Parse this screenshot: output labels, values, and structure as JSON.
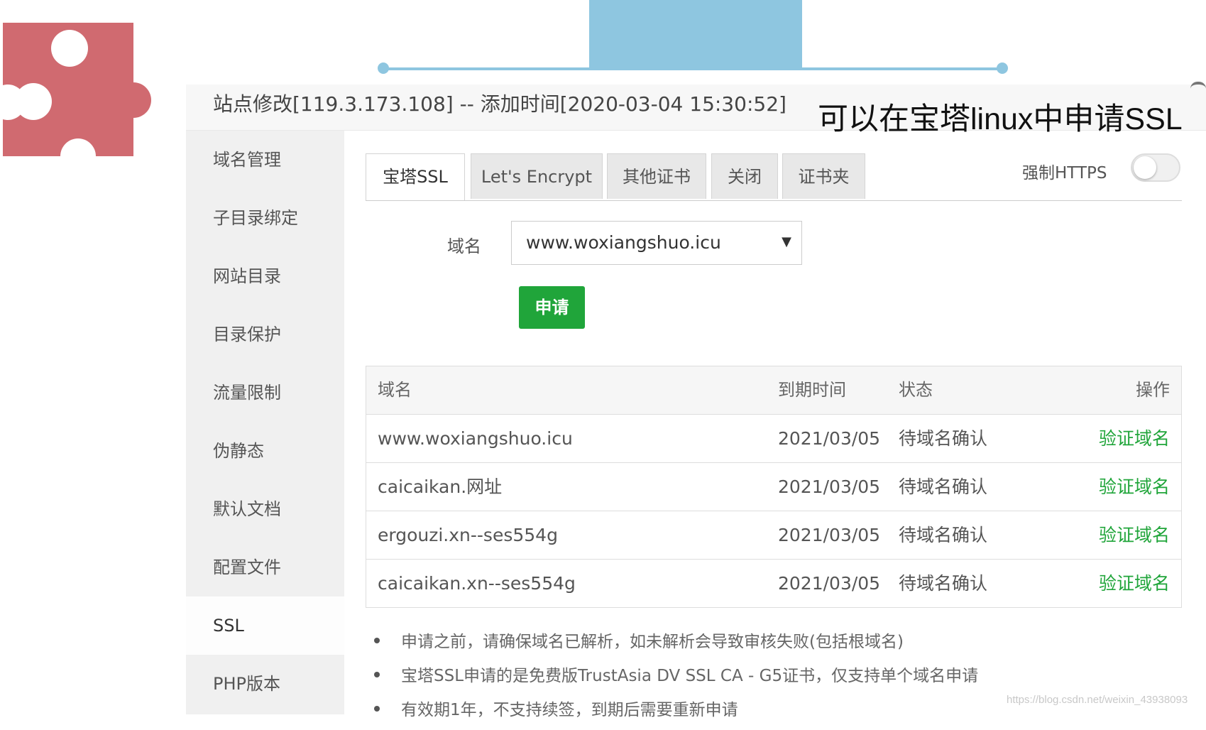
{
  "panel": {
    "title": "站点修改[119.3.173.108] -- 添加时间[2020-03-04 15:30:52]"
  },
  "callout": "可以在宝塔linux中申请SSL",
  "sidebar": {
    "items": [
      {
        "label": "域名管理"
      },
      {
        "label": "子目录绑定"
      },
      {
        "label": "网站目录"
      },
      {
        "label": "目录保护"
      },
      {
        "label": "流量限制"
      },
      {
        "label": "伪静态"
      },
      {
        "label": "默认文档"
      },
      {
        "label": "配置文件"
      },
      {
        "label": "SSL",
        "active": true
      },
      {
        "label": "PHP版本"
      }
    ]
  },
  "tabs": [
    {
      "label": "宝塔SSL",
      "active": true
    },
    {
      "label": "Let's Encrypt"
    },
    {
      "label": "其他证书"
    },
    {
      "label": "关闭"
    },
    {
      "label": "证书夹"
    }
  ],
  "force_https": {
    "label": "强制HTTPS",
    "enabled": false
  },
  "form": {
    "domain_label": "域名",
    "domain_value": "www.woxiangshuo.icu",
    "apply_label": "申请"
  },
  "table": {
    "headers": {
      "domain": "域名",
      "expire": "到期时间",
      "status": "状态",
      "action": "操作"
    },
    "rows": [
      {
        "domain": "www.woxiangshuo.icu",
        "expire": "2021/03/05",
        "status": "待域名确认",
        "action": "验证域名"
      },
      {
        "domain": "caicaikan.网址",
        "expire": "2021/03/05",
        "status": "待域名确认",
        "action": "验证域名"
      },
      {
        "domain": "ergouzi.xn--ses554g",
        "expire": "2021/03/05",
        "status": "待域名确认",
        "action": "验证域名"
      },
      {
        "domain": "caicaikan.xn--ses554g",
        "expire": "2021/03/05",
        "status": "待域名确认",
        "action": "验证域名"
      }
    ]
  },
  "notes": [
    "申请之前，请确保域名已解析，如未解析会导致审核失败(包括根域名)",
    "宝塔SSL申请的是免费版TrustAsia DV SSL CA - G5证书，仅支持单个域名申请",
    "有效期1年，不支持续签，到期后需要重新申请"
  ],
  "watermark": "https://blog.csdn.net/weixin_43938093",
  "colors": {
    "accent_green": "#20a53a",
    "deco_blue": "#8ec6e0",
    "puzzle_red": "#d06a70"
  }
}
